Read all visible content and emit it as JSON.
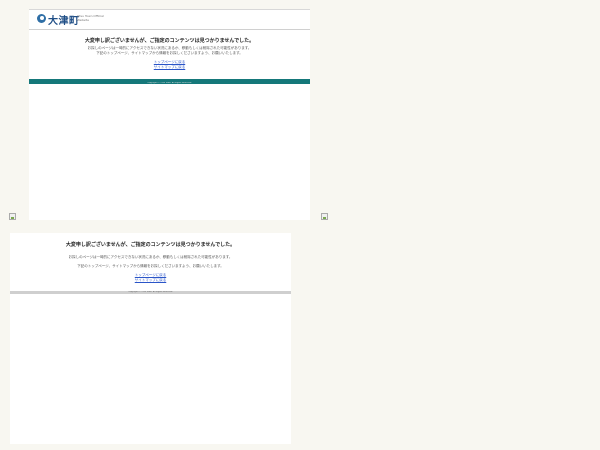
{
  "top_page": {
    "logo": {
      "name": "大津町",
      "sub": "Otsu Town Official Website"
    },
    "title": "大変申し訳ございませんが、ご指定のコンテンツは見つかりませんでした。",
    "body_lines": [
      "お探しのページは一時的にアクセスできない状況にあるか、移動もしくは削除された可能性があります。",
      "下記のトップページ、サイトマップから情報をお探しくださいますよう、お願いいたします。"
    ],
    "links": {
      "top": "トップページに戻る",
      "sitemap": "サイトマップに戻る"
    },
    "copyright": "Copyright (C) Ozu Town. All Rights Reserved."
  },
  "bottom_page": {
    "title": "大変申し訳ございませんが、ご指定のコンテンツは見つかりませんでした。",
    "body_lines": [
      "お探しのページは一時的にアクセスできない状況にあるか、移動もしくは削除された可能性があります。",
      "下記のトップページ、サイトマップから情報をお探しくださいますよう、お願いいたします。"
    ],
    "links": {
      "top": "トップページに戻る",
      "sitemap": "サイトマップに戻る"
    },
    "copyright": "Copyright (C) Ozu Town. All Rights Reserved."
  },
  "icons": {
    "broken_image": "broken-image-icon",
    "logo": "town-logo-icon"
  },
  "colors": {
    "accent_teal": "#15787a",
    "link": "#2a55c8",
    "logo": "#1f4e86",
    "background": "#f8f7f1"
  }
}
